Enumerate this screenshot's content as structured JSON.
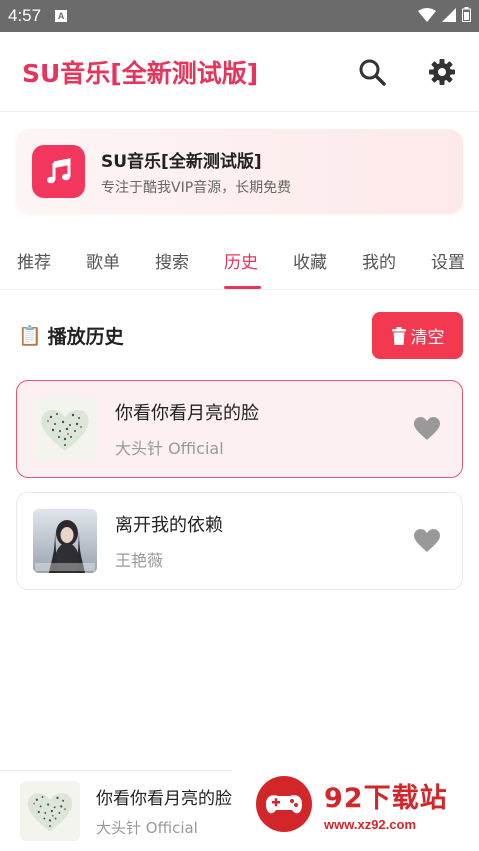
{
  "status_bar": {
    "time": "4:57",
    "notification_icon": "A"
  },
  "header": {
    "title": "SU音乐[全新测试版]",
    "icons": [
      "search-icon",
      "gear-icon"
    ]
  },
  "banner": {
    "title": "SU音乐[全新测试版]",
    "subtitle": "专注于酷我VIP音源，长期免费",
    "icon": "music-note-icon"
  },
  "tabs": [
    {
      "label": "推荐"
    },
    {
      "label": "歌单"
    },
    {
      "label": "搜索"
    },
    {
      "label": "历史"
    },
    {
      "label": "收藏"
    },
    {
      "label": "我的"
    },
    {
      "label": "设置"
    }
  ],
  "active_tab": "历史",
  "history": {
    "title_icon": "📋",
    "title": "播放历史",
    "clear_label": "清空",
    "songs": [
      {
        "title": "你看你看月亮的脸",
        "artist": "大头针 Official",
        "active": true
      },
      {
        "title": "离开我的依赖",
        "artist": "王艳薇",
        "active": false
      }
    ]
  },
  "player": {
    "title": "你看你看月亮的脸",
    "artist": "大头针 Official"
  },
  "watermark": {
    "name": "92下载站",
    "url": "www.xz92.com"
  },
  "colors": {
    "accent": "#e8345a",
    "clear_button": "#f2394f",
    "watermark": "#d3262b"
  }
}
